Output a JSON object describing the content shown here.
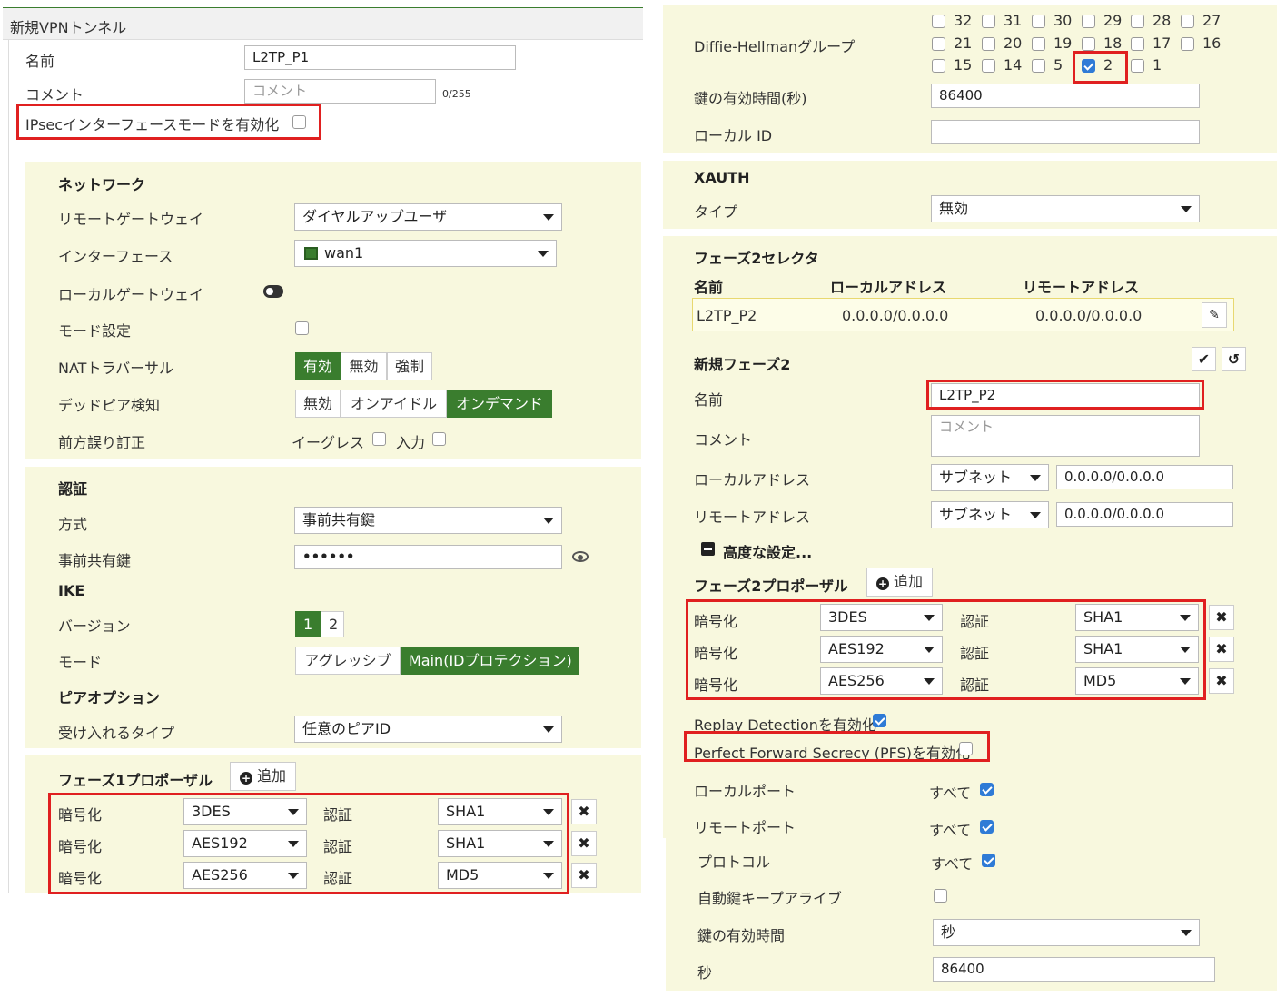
{
  "left": {
    "window_title": "新規VPNトンネル",
    "name_label": "名前",
    "name_value": "L2TP_P1",
    "comment_label": "コメント",
    "comment_placeholder": "コメント",
    "comment_count": "0/255",
    "ipsec_mode_label": "IPsecインターフェースモードを有効化",
    "network": {
      "title": "ネットワーク",
      "remote_gw_label": "リモートゲートウェイ",
      "remote_gw_value": "ダイヤルアップユーザ",
      "interface_label": "インターフェース",
      "interface_value": "wan1",
      "local_gw_label": "ローカルゲートウェイ",
      "mode_label": "モード設定",
      "nat_label": "NATトラバーサル",
      "nat_options": [
        "有効",
        "無効",
        "強制"
      ],
      "dpd_label": "デッドピア検知",
      "dpd_options": [
        "無効",
        "オンアイドル",
        "オンデマンド"
      ],
      "fec_label": "前方誤り訂正",
      "fec_egress": "イーグレス",
      "fec_ingress": "入力"
    },
    "auth": {
      "title": "認証",
      "method_label": "方式",
      "method_value": "事前共有鍵",
      "psk_label": "事前共有鍵",
      "psk_value": "••••••",
      "ike_title": "IKE",
      "version_label": "バージョン",
      "version_options": [
        "1",
        "2"
      ],
      "mode_label": "モード",
      "mode_options": [
        "アグレッシブ",
        "Main(IDプロテクション)"
      ],
      "peer_title": "ピアオプション",
      "accept_label": "受け入れるタイプ",
      "accept_value": "任意のピアID"
    },
    "phase1": {
      "title": "フェーズ1プロポーザル",
      "add_label": "追加",
      "enc_label": "暗号化",
      "auth_label": "認証",
      "rows": [
        {
          "enc": "3DES",
          "auth": "SHA1"
        },
        {
          "enc": "AES192",
          "auth": "SHA1"
        },
        {
          "enc": "AES256",
          "auth": "MD5"
        }
      ]
    }
  },
  "right": {
    "dh_label": "Diffie-Hellmanグループ",
    "dh_groups": [
      {
        "n": "32",
        "on": false
      },
      {
        "n": "31",
        "on": false
      },
      {
        "n": "30",
        "on": false
      },
      {
        "n": "29",
        "on": false
      },
      {
        "n": "28",
        "on": false
      },
      {
        "n": "27",
        "on": false
      },
      {
        "n": "21",
        "on": false
      },
      {
        "n": "20",
        "on": false
      },
      {
        "n": "19",
        "on": false
      },
      {
        "n": "18",
        "on": false
      },
      {
        "n": "17",
        "on": false
      },
      {
        "n": "16",
        "on": false
      },
      {
        "n": "15",
        "on": false
      },
      {
        "n": "14",
        "on": false
      },
      {
        "n": "5",
        "on": false
      },
      {
        "n": "2",
        "on": true
      },
      {
        "n": "1",
        "on": false
      }
    ],
    "keylife_label": "鍵の有効時間(秒)",
    "keylife_value": "86400",
    "localid_label": "ローカル ID",
    "xauth_title": "XAUTH",
    "type_label": "タイプ",
    "type_value": "無効",
    "p2sel": {
      "title": "フェーズ2セレクタ",
      "col_name": "名前",
      "col_local": "ローカルアドレス",
      "col_remote": "リモートアドレス",
      "row_name": "L2TP_P2",
      "row_local": "0.0.0.0/0.0.0.0",
      "row_remote": "0.0.0.0/0.0.0.0"
    },
    "newp2": {
      "title": "新規フェーズ2",
      "name_label": "名前",
      "name_value": "L2TP_P2",
      "comment_label": "コメント",
      "comment_placeholder": "コメント",
      "local_label": "ローカルアドレス",
      "local_type": "サブネット",
      "local_value": "0.0.0.0/0.0.0.0",
      "remote_label": "リモートアドレス",
      "remote_type": "サブネット",
      "remote_value": "0.0.0.0/0.0.0.0",
      "advanced_label": "高度な設定..."
    },
    "phase2": {
      "title": "フェーズ2プロポーザル",
      "add_label": "追加",
      "enc_label": "暗号化",
      "auth_label": "認証",
      "rows": [
        {
          "enc": "3DES",
          "auth": "SHA1"
        },
        {
          "enc": "AES192",
          "auth": "SHA1"
        },
        {
          "enc": "AES256",
          "auth": "MD5"
        }
      ]
    },
    "replay_label": "Replay Detectionを有効化",
    "pfs_label": "Perfect Forward Secrecy (PFS)を有効化",
    "local_port_label": "ローカルポート",
    "remote_port_label": "リモートポート",
    "protocol_label": "プロトコル",
    "all_label": "すべて",
    "keepalive_label": "自動鍵キープアライブ",
    "keylife2_label": "鍵の有効時間",
    "keylife2_value": "秒",
    "seconds_label": "秒",
    "seconds_value": "86400"
  },
  "colors": {
    "accent_green": "#3a7d2e",
    "highlight_red": "#e02020",
    "panel": "#f8f8de",
    "check_blue": "#2f7bd6"
  }
}
